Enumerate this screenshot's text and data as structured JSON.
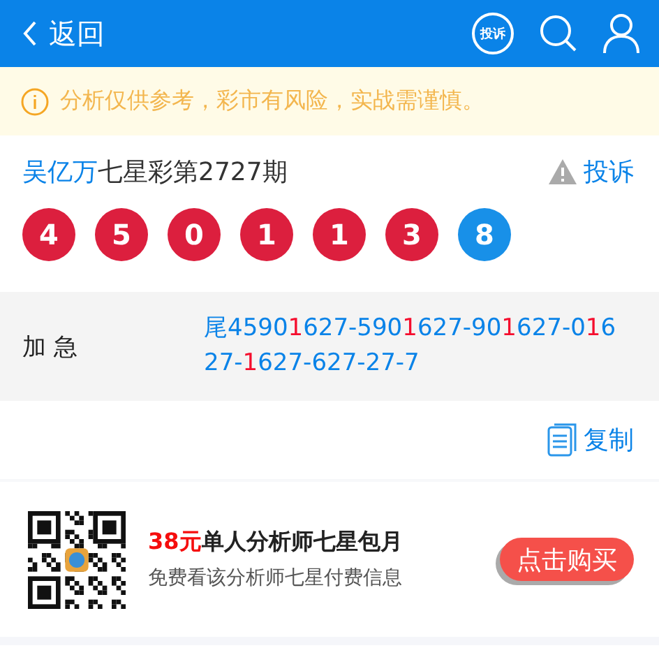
{
  "header": {
    "back_label": "返回",
    "complain_badge": "投诉"
  },
  "notice": "分析仅供参考，彩市有风险，实战需谨慎。",
  "draw": {
    "analyst": "吴亿万",
    "title": "七星彩第2727期",
    "report_label": "投诉",
    "balls": [
      {
        "number": "4",
        "color": "#dc1f3e"
      },
      {
        "number": "5",
        "color": "#dc1f3e"
      },
      {
        "number": "0",
        "color": "#dc1f3e"
      },
      {
        "number": "1",
        "color": "#dc1f3e"
      },
      {
        "number": "1",
        "color": "#dc1f3e"
      },
      {
        "number": "3",
        "color": "#dc1f3e"
      },
      {
        "number": "8",
        "color": "#1890e8"
      }
    ]
  },
  "prediction": {
    "label": "加 急",
    "segments": [
      {
        "text": "尾4590",
        "highlight": false
      },
      {
        "text": "1",
        "highlight": true
      },
      {
        "text": "627-590",
        "highlight": false
      },
      {
        "text": "1",
        "highlight": true
      },
      {
        "text": "627-90",
        "highlight": false
      },
      {
        "text": "1",
        "highlight": true
      },
      {
        "text": "627-0",
        "highlight": false
      },
      {
        "text": "1",
        "highlight": true
      },
      {
        "text": "627-",
        "highlight": false
      },
      {
        "text": "1",
        "highlight": true
      },
      {
        "text": "627-627-27-7",
        "highlight": false
      }
    ]
  },
  "copy_label": "复制",
  "promo": {
    "price": "38元",
    "title": "单人分析师七星包月",
    "subtitle": "免费看该分析师七星付费信息",
    "button": "点击购买"
  }
}
